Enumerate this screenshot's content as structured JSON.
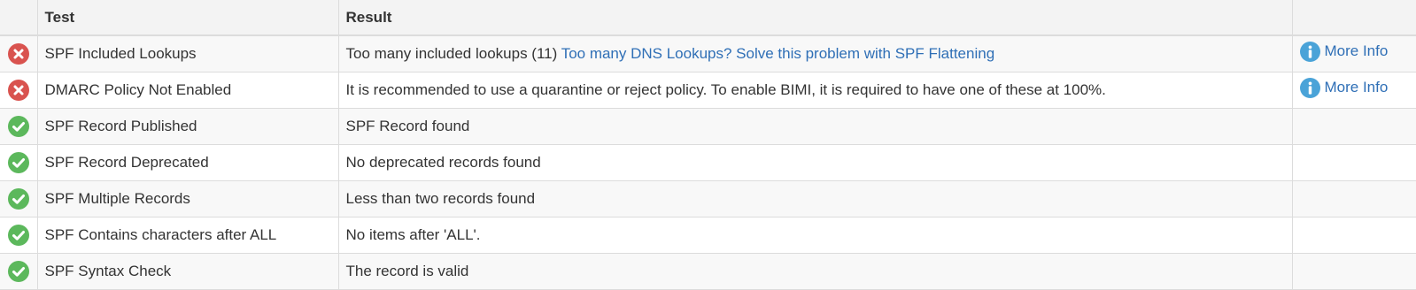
{
  "table": {
    "headers": {
      "status": "",
      "test": "Test",
      "result": "Result",
      "info": ""
    },
    "rows": [
      {
        "status": "error",
        "test": "SPF Included Lookups",
        "result": "Too many included lookups (11)",
        "link": "Too many DNS Lookups? Solve this problem with SPF Flattening",
        "info": "More Info"
      },
      {
        "status": "error",
        "test": "DMARC Policy Not Enabled",
        "result": "It is recommended to use a quarantine or reject policy. To enable BIMI, it is required to have one of these at 100%.",
        "link": "",
        "info": "More Info"
      },
      {
        "status": "pass",
        "test": "SPF Record Published",
        "result": "SPF Record found",
        "link": "",
        "info": ""
      },
      {
        "status": "pass",
        "test": "SPF Record Deprecated",
        "result": "No deprecated records found",
        "link": "",
        "info": ""
      },
      {
        "status": "pass",
        "test": "SPF Multiple Records",
        "result": "Less than two records found",
        "link": "",
        "info": ""
      },
      {
        "status": "pass",
        "test": "SPF Contains characters after ALL",
        "result": "No items after 'ALL'.",
        "link": "",
        "info": ""
      },
      {
        "status": "pass",
        "test": "SPF Syntax Check",
        "result": "The record is valid",
        "link": "",
        "info": ""
      }
    ]
  },
  "colors": {
    "error": "#d9534f",
    "pass": "#5cb85c",
    "link": "#2f6fb6",
    "info_icon": "#4aa3d8"
  },
  "icons": {
    "error": "x-circle-icon",
    "pass": "check-circle-icon",
    "info": "info-circle-icon"
  }
}
